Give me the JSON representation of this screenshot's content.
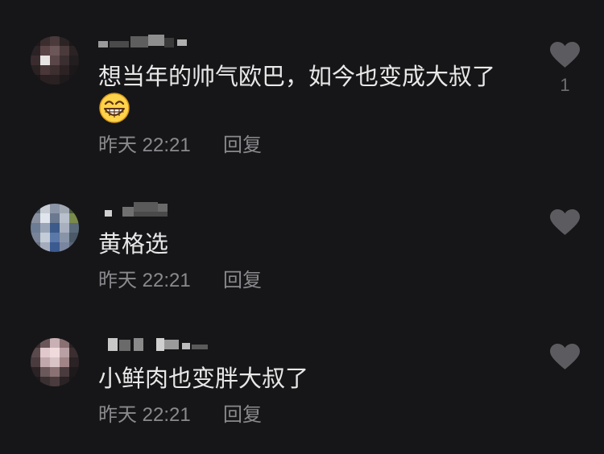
{
  "theme": {
    "background": "#161618",
    "comment_text": "#e8e8e8",
    "meta_text": "#8a8a8e",
    "like_icon": "#5c5c60"
  },
  "comments": [
    {
      "text": "想当年的帅气欧巴，如今也变成大叔了",
      "emoji": "beaming-grin-emoji",
      "time": "昨天 22:21",
      "reply_label": "回复",
      "like_icon": "heart-icon",
      "like_count": "1"
    },
    {
      "text": "黄格选",
      "time": "昨天 22:21",
      "reply_label": "回复",
      "like_icon": "heart-icon"
    },
    {
      "text": "小鲜肉也变胖大叔了",
      "time": "昨天 22:21",
      "reply_label": "回复",
      "like_icon": "heart-icon"
    }
  ]
}
